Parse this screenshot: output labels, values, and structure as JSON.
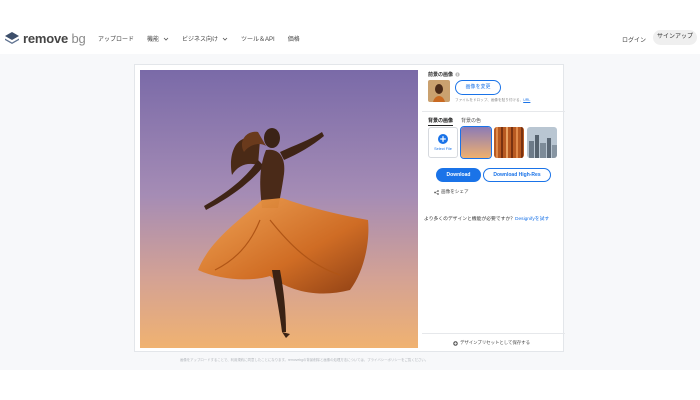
{
  "header": {
    "logo": {
      "text_main": "remove",
      "text_bg": "bg"
    },
    "nav": [
      {
        "label": "アップロード",
        "has_dropdown": false
      },
      {
        "label": "機能",
        "has_dropdown": true
      },
      {
        "label": "ビジネス向け",
        "has_dropdown": true
      },
      {
        "label": "ツール＆API",
        "has_dropdown": false
      },
      {
        "label": "価格",
        "has_dropdown": false
      }
    ],
    "login_label": "ログイン",
    "signup_label": "サインアップ"
  },
  "editor": {
    "original_title": "前景の画像",
    "change_image_label": "画像を変更",
    "drop_text": "ファイルをドロップ、画像を貼り付ける、",
    "drop_link": "URL",
    "tabs": [
      {
        "label": "背景の画像",
        "active": true
      },
      {
        "label": "背景の色",
        "active": false
      }
    ],
    "select_file_label": "Select File",
    "download_label": "Download",
    "download_hr_label": "Download High-Res",
    "share_label": "画像をシェア",
    "promo_text": "より多くのデザインと機能が必要ですか？",
    "promo_link": "Designifyを試す",
    "preset_label": "デザインプリセットとして保存する"
  },
  "footer_text": "画像をアップロードすることで、利用規約に同意したことになります。removebgの背景削除と画像の処理方法については、プライバシーポリシーをご覧ください。",
  "colors": {
    "accent": "#1a73e8",
    "band": "#f7f8fa"
  },
  "icons": [
    "logo-mark-icon",
    "chevron-down-icon",
    "info-icon",
    "plus-icon",
    "share-icon",
    "preset-plus-icon"
  ]
}
